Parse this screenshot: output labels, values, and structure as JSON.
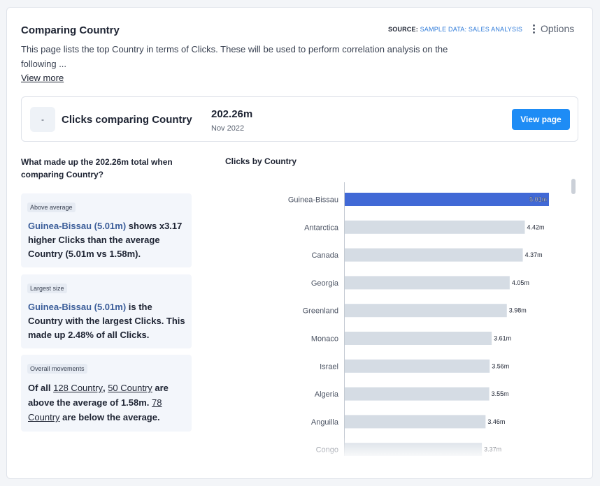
{
  "header": {
    "title": "Comparing Country",
    "source_label": "SOURCE:",
    "source_value": "SAMPLE DATA: SALES ANALYSIS",
    "options_label": "Options"
  },
  "description": "This page lists the top Country in terms of Clicks. These will be used to perform correlation analysis on the following ...",
  "view_more": "View more",
  "summary": {
    "icon_text": "-",
    "label": "Clicks comparing Country",
    "value": "202.26m",
    "date": "Nov 2022",
    "button": "View page"
  },
  "question": "What made up the 202.26m total when comparing Country?",
  "insights": {
    "above": {
      "badge": "Above average",
      "highlight": "Guinea-Bissau (5.01m)",
      "text": " shows x3.17 higher Clicks than the average Country (5.01m vs 1.58m)."
    },
    "largest": {
      "badge": "Largest size",
      "highlight": "Guinea-Bissau (5.01m)",
      "text": " is the Country with the largest Clicks. This made up 2.48% of all Clicks."
    },
    "overall": {
      "badge": "Overall movements",
      "prefix": "Of all ",
      "link_total": "128 Country",
      "comma": ", ",
      "link_above": "50 Country",
      "mid": " are above the average of 1.58m.",
      "link_below": "78 Country",
      "suffix": " are below the average."
    }
  },
  "colors": {
    "highlight_bar": "#4169d6",
    "bar": "#d5dce4",
    "axis": "#c3c9d2"
  },
  "chart_data": {
    "type": "bar",
    "orientation": "horizontal",
    "title": "Clicks by Country",
    "categories": [
      "Guinea-Bissau",
      "Antarctica",
      "Canada",
      "Georgia",
      "Greenland",
      "Monaco",
      "Israel",
      "Algeria",
      "Anguilla",
      "Congo"
    ],
    "values": [
      5.01,
      4.42,
      4.37,
      4.05,
      3.98,
      3.61,
      3.56,
      3.55,
      3.46,
      3.37
    ],
    "labels": [
      "5.01m",
      "4.42m",
      "4.37m",
      "4.05m",
      "3.98m",
      "3.61m",
      "3.56m",
      "3.55m",
      "3.46m",
      "3.37m"
    ],
    "highlight_index": 0,
    "xlim": [
      0,
      5.01
    ],
    "grid": false
  }
}
